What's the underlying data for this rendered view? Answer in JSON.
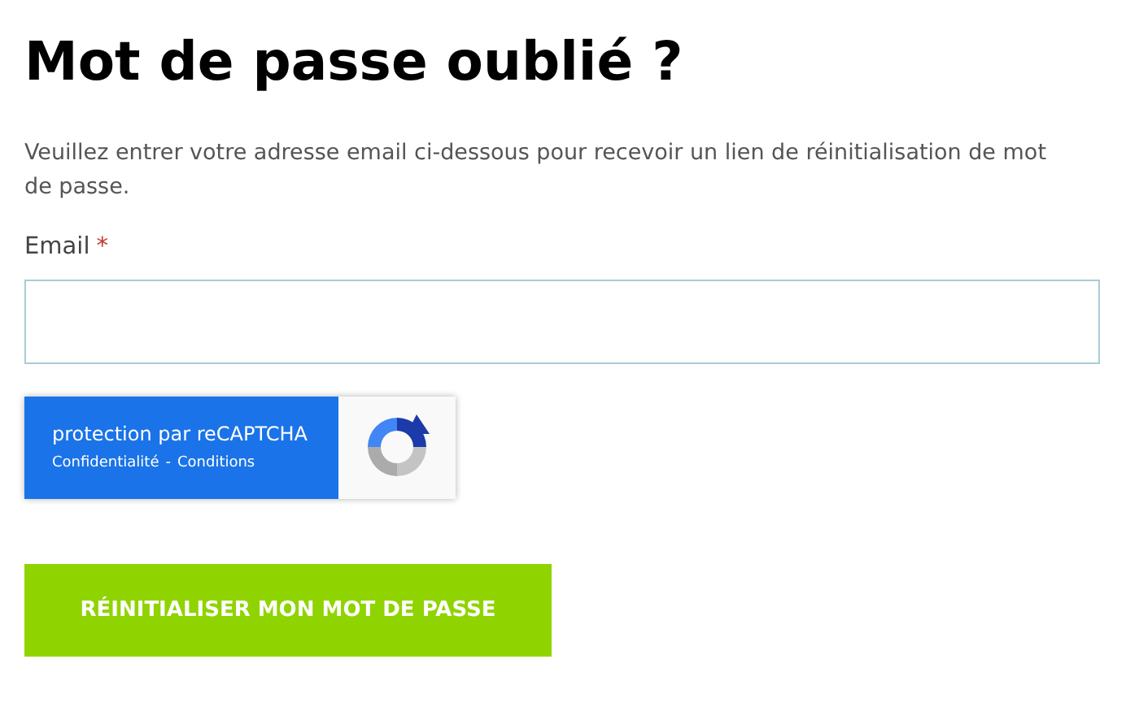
{
  "title": "Mot de passe oublié ?",
  "intro": "Veuillez entrer votre adresse email ci-dessous pour recevoir un lien de réinitialisation de mot de passe.",
  "email_field": {
    "label": "Email",
    "required_mark": "*"
  },
  "recaptcha": {
    "text": "protection par reCAPTCHA",
    "privacy_link": "Confidentialité",
    "separator": "-",
    "terms_link": "Conditions"
  },
  "submit_button": "RÉINITIALISER MON MOT DE PASSE"
}
